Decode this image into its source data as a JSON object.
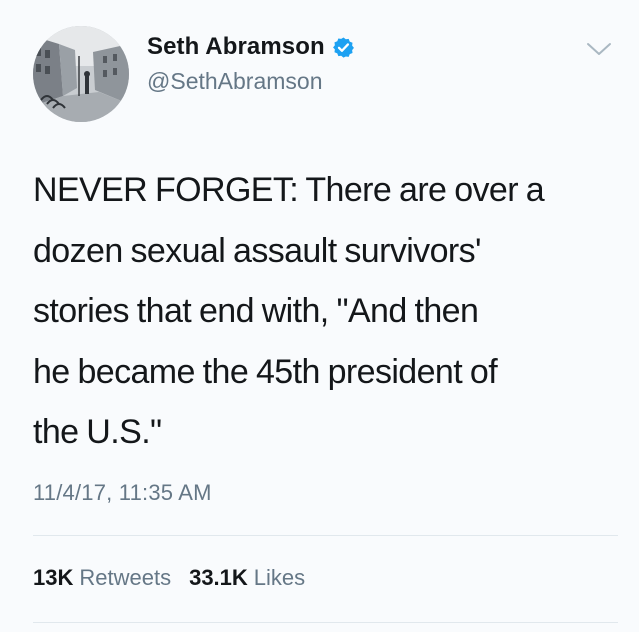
{
  "tweet": {
    "author": {
      "display_name": "Seth Abramson",
      "handle": "@SethAbramson",
      "verified": true,
      "verified_color": "#1da1f2"
    },
    "menu_icon": "chevron-down-icon",
    "text_lines": [
      "NEVER FORGET: There are over a",
      "dozen sexual assault survivors'",
      "stories that end with, \"And then",
      "he became the 45th president of",
      "the U.S.\""
    ],
    "timestamp": "11/4/17, 11:35 AM",
    "stats": {
      "retweets_count": "13K",
      "retweets_label": "Retweets",
      "likes_count": "33.1K",
      "likes_label": "Likes"
    }
  }
}
